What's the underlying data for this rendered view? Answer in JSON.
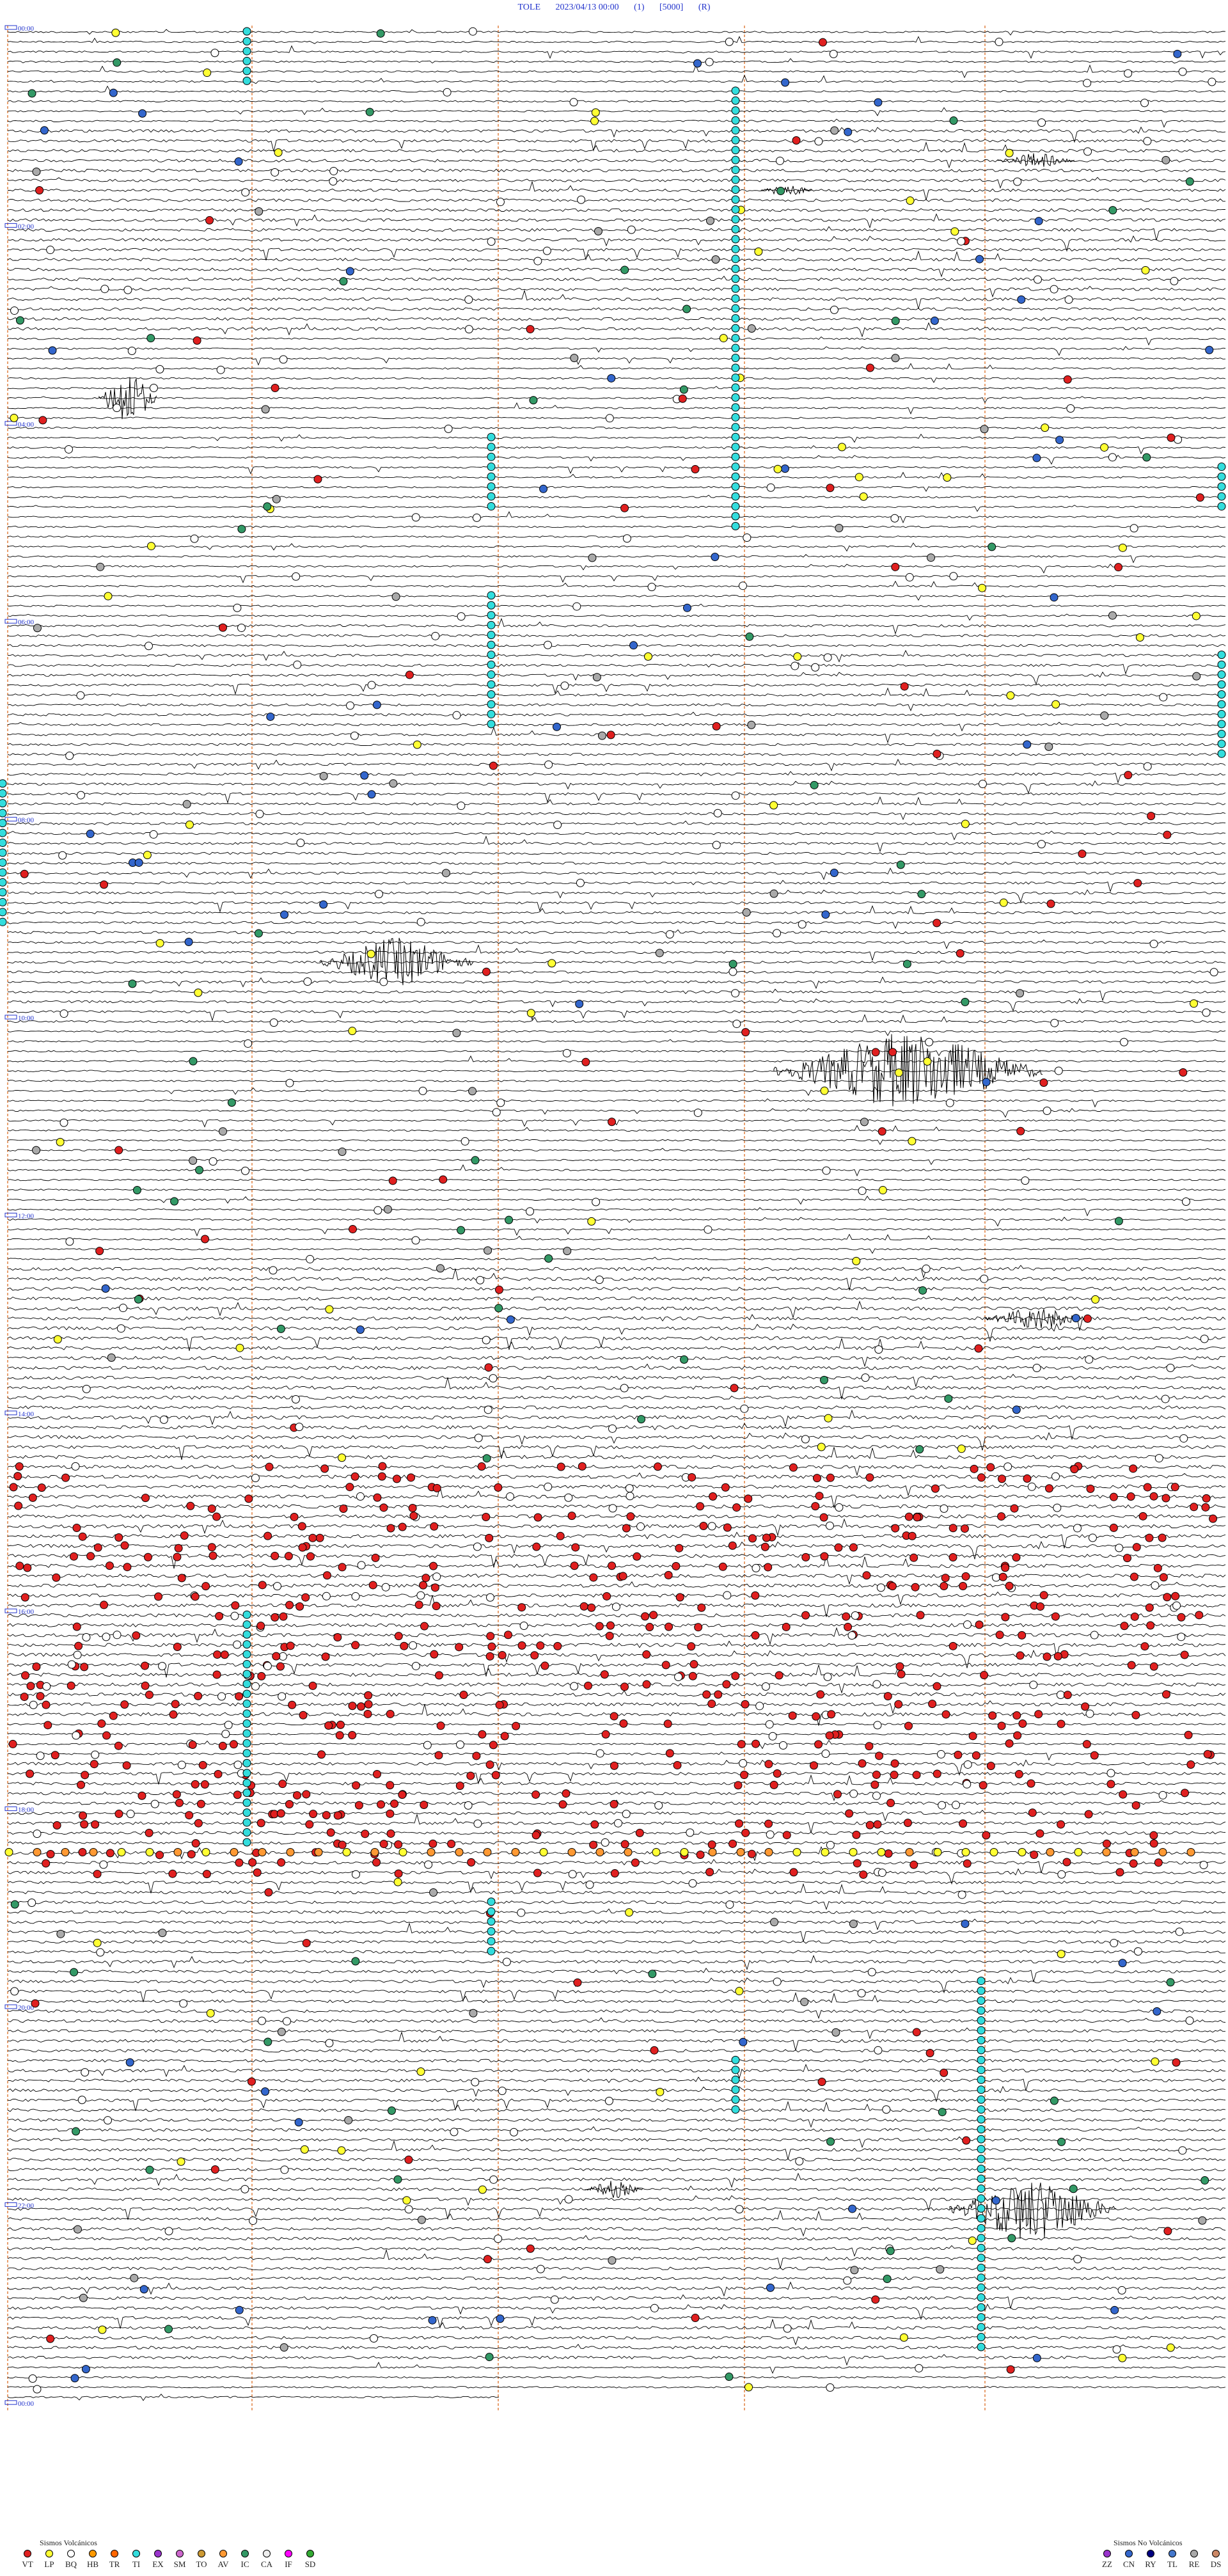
{
  "header": {
    "station": "TOLE",
    "datetime": "2023/04/13 00:00",
    "component": "(1)",
    "gain": "[5000]",
    "mode": "(R)"
  },
  "hour_labels": [
    "00:00",
    "02:00",
    "04:00",
    "06:00",
    "08:00",
    "10:00",
    "12:00",
    "14:00",
    "16:00",
    "18:00",
    "20:00",
    "22:00",
    "00:00"
  ],
  "legend_volcanic": {
    "title": "Sismos Volcánicos",
    "items": [
      {
        "code": "VT",
        "color": "#e02020"
      },
      {
        "code": "LP",
        "color": "#ffff33"
      },
      {
        "code": "BQ",
        "color": "#ffffff"
      },
      {
        "code": "HB",
        "color": "#ff9900"
      },
      {
        "code": "TR",
        "color": "#ff6600"
      },
      {
        "code": "TI",
        "color": "#33dddd"
      },
      {
        "code": "EX",
        "color": "#9933cc"
      },
      {
        "code": "SM",
        "color": "#cc66cc"
      },
      {
        "code": "TO",
        "color": "#cc9933"
      },
      {
        "code": "AV",
        "color": "#ff9933"
      },
      {
        "code": "IC",
        "color": "#339966"
      },
      {
        "code": "CA",
        "color": "#eeeeee"
      },
      {
        "code": "IF",
        "color": "#ff00ff"
      },
      {
        "code": "SD",
        "color": "#33aa33"
      }
    ]
  },
  "legend_nonvolcanic": {
    "title": "Sismos No Volcánicos",
    "items": [
      {
        "code": "ZZ",
        "color": "#9933cc"
      },
      {
        "code": "CN",
        "color": "#3366cc"
      },
      {
        "code": "RY",
        "color": "#000080"
      },
      {
        "code": "TL",
        "color": "#4477cc"
      },
      {
        "code": "RE",
        "color": "#aaaaaa"
      },
      {
        "code": "DS",
        "color": "#cc8866"
      }
    ]
  },
  "colors": {
    "hour_label": "#2233cc",
    "minute_marker": "#e08040",
    "trace": "#000000",
    "event_vt": "#e02020",
    "event_lp": "#ffff33",
    "event_bq": "#ffffff",
    "event_ti": "#33dddd",
    "event_ic": "#339966",
    "event_cn": "#3366cc",
    "event_av": "#ff9933",
    "event_re": "#aaaaaa"
  }
}
